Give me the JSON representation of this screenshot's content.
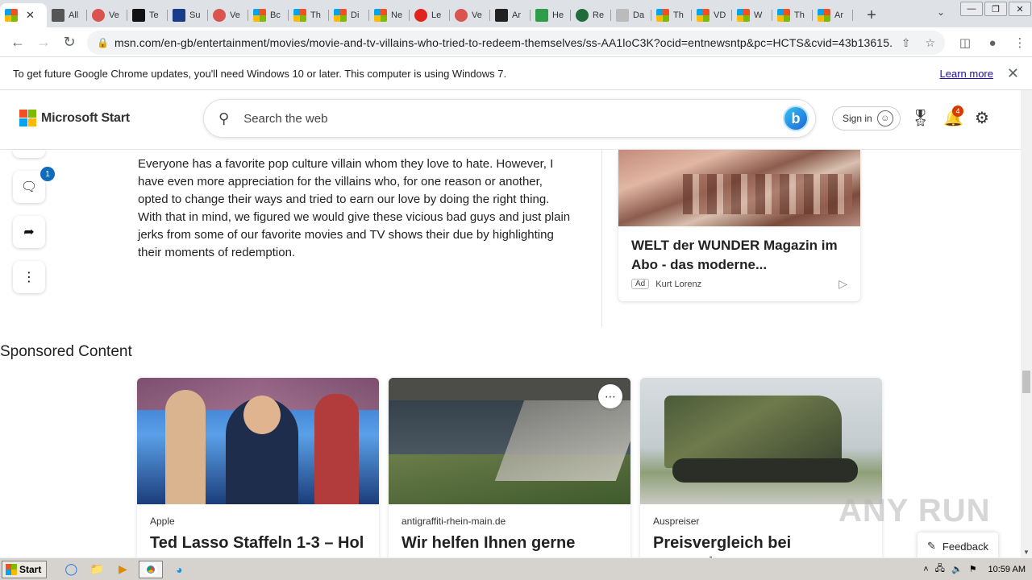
{
  "tabs": [
    {
      "label": "",
      "favicon": "microsoft-icon",
      "active": true
    },
    {
      "label": "All",
      "favicon": "pen-icon"
    },
    {
      "label": "Ve",
      "favicon": "red-circle-icon"
    },
    {
      "label": "Te",
      "favicon": "appletv-icon"
    },
    {
      "label": "Su",
      "favicon": "wb-icon"
    },
    {
      "label": "Ve",
      "favicon": "red-circle-icon"
    },
    {
      "label": "Bc",
      "favicon": "microsoft-icon"
    },
    {
      "label": "Th",
      "favicon": "microsoft-icon"
    },
    {
      "label": "Di",
      "favicon": "microsoft-icon"
    },
    {
      "label": "Ne",
      "favicon": "microsoft-icon"
    },
    {
      "label": "Le",
      "favicon": "red-arc-icon"
    },
    {
      "label": "Ve",
      "favicon": "red-circle-icon"
    },
    {
      "label": "Ar",
      "favicon": "amazon-icon"
    },
    {
      "label": "He",
      "favicon": "tag-icon"
    },
    {
      "label": "Re",
      "favicon": "green-circle-icon"
    },
    {
      "label": "Da",
      "favicon": "cecil-icon"
    },
    {
      "label": "Th",
      "favicon": "microsoft-icon"
    },
    {
      "label": "VD",
      "favicon": "microsoft-icon"
    },
    {
      "label": "W",
      "favicon": "microsoft-icon"
    },
    {
      "label": "Th",
      "favicon": "microsoft-icon"
    },
    {
      "label": "Ar",
      "favicon": "microsoft-icon"
    }
  ],
  "browser": {
    "url": "msn.com/en-gb/entertainment/movies/movie-and-tv-villains-who-tried-to-redeem-themselves/ss-AA1loC3K?ocid=entnewsntp&pc=HCTS&cvid=43b13615...",
    "new_tab_symbol": "+",
    "tab_search_symbol": "⌄",
    "win_min": "—",
    "win_max": "❐",
    "win_close": "✕"
  },
  "infobar": {
    "message": "To get future Google Chrome updates, you'll need Windows 10 or later. This computer is using Windows 7.",
    "link": "Learn more",
    "close": "✕"
  },
  "msn": {
    "brand": "Microsoft Start",
    "search_placeholder": "Search the web",
    "bing_label": "b",
    "signin": "Sign in",
    "notifications_count": "4"
  },
  "rail": {
    "comment_count": "1"
  },
  "article": {
    "body": "Everyone has a favorite pop culture villain whom they love to hate. However, I have even more appreciation for the villains who, for one reason or another, opted to change their ways and tried to earn our love by doing the right thing. With that in mind, we figured we would give these vicious bad guys and just plain jerks from some of our favorite movies and TV shows their due by highlighting their moments of redemption."
  },
  "ad": {
    "title": "WELT der WUNDER Magazin im Abo - das moderne...",
    "tag": "Ad",
    "advertiser": "Kurt Lorenz"
  },
  "sponsored": {
    "heading": "Sponsored Content",
    "cards": [
      {
        "source": "Apple",
        "title": "Ted Lasso Staffeln 1-3 – Hol"
      },
      {
        "source": "antigraffiti-rhein-main.de",
        "title": "Wir helfen Ihnen gerne"
      },
      {
        "source": "Auspreiser",
        "title": "Preisvergleich bei Auspreiser"
      }
    ]
  },
  "feedback": {
    "label": "Feedback"
  },
  "watermark": "ANY RUN",
  "taskbar": {
    "start": "Start",
    "clock": "10:59 AM"
  },
  "colors": {
    "ms_red": "#f25022",
    "ms_green": "#7fba00",
    "ms_blue": "#00a4ef",
    "ms_yellow": "#ffb900",
    "badge_blue": "#0f6cbd",
    "badge_orange": "#d83b01"
  }
}
